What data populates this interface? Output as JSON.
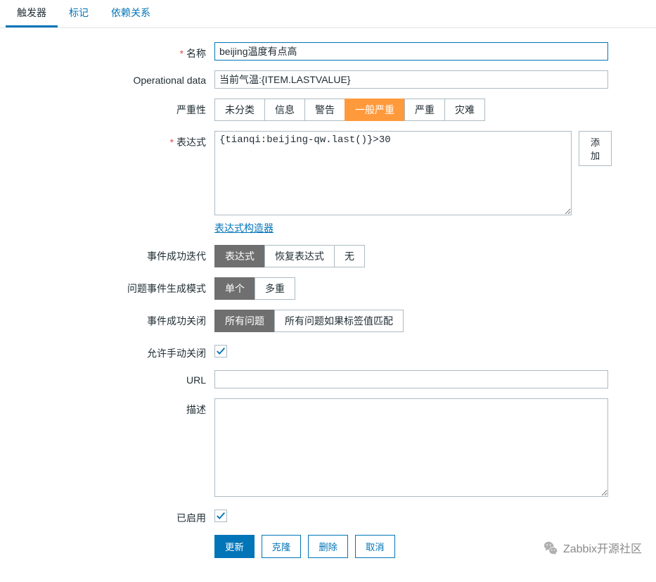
{
  "tabs": {
    "trigger": "触发器",
    "tag": "标记",
    "dep": "依赖关系"
  },
  "labels": {
    "name": "名称",
    "opdata": "Operational data",
    "severity": "严重性",
    "expr": "表达式",
    "expr_builder": "表达式构造器",
    "add": "添加",
    "ok_iter": "事件成功迭代",
    "prob_mode": "问题事件生成模式",
    "ok_close": "事件成功关闭",
    "manual_close": "允许手动关闭",
    "url": "URL",
    "desc": "描述",
    "enabled": "已启用"
  },
  "values": {
    "name": "beijing温度有点高",
    "opdata": "当前气温:{ITEM.LASTVALUE}",
    "expr": "{tianqi:beijing-qw.last()}>30",
    "url": "",
    "desc": ""
  },
  "severity": [
    "未分类",
    "信息",
    "警告",
    "一般严重",
    "严重",
    "灾难"
  ],
  "ok_iter": [
    "表达式",
    "恢复表达式",
    "无"
  ],
  "prob_mode": [
    "单个",
    "多重"
  ],
  "ok_close": [
    "所有问题",
    "所有问题如果标签值匹配"
  ],
  "buttons": {
    "update": "更新",
    "clone": "克隆",
    "delete": "删除",
    "cancel": "取消"
  },
  "watermark": "Zabbix开源社区"
}
